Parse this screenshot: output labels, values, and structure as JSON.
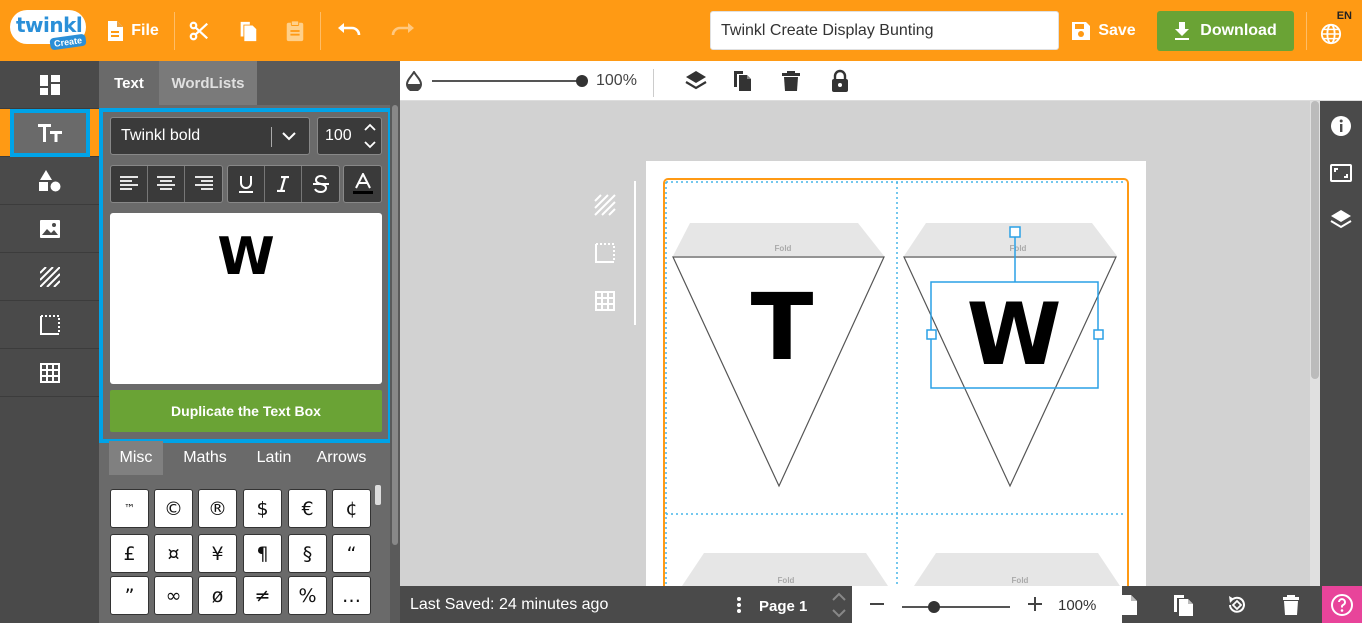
{
  "app": {
    "name": "Twinkl Create",
    "logo_word": "twinkl",
    "logo_badge": "Create"
  },
  "topbar": {
    "file_label": "File",
    "document_title": "Twinkl Create Display Bunting",
    "save_label": "Save",
    "download_label": "Download",
    "language_code": "EN",
    "icons": [
      "file-icon",
      "scissors-icon",
      "copy-icon",
      "paste-icon",
      "undo-icon",
      "redo-icon",
      "save-icon",
      "download-icon",
      "globe-icon"
    ]
  },
  "rail": {
    "items": [
      {
        "name": "templates",
        "icon": "dashboard-icon"
      },
      {
        "name": "text",
        "icon": "text-icon",
        "active": true
      },
      {
        "name": "shapes",
        "icon": "shapes-icon"
      },
      {
        "name": "images",
        "icon": "image-icon"
      },
      {
        "name": "background",
        "icon": "pattern-icon"
      },
      {
        "name": "borders",
        "icon": "border-icon"
      },
      {
        "name": "tables",
        "icon": "grid-icon"
      }
    ]
  },
  "panel": {
    "tabs": [
      {
        "label": "Text",
        "active": true
      },
      {
        "label": "WordLists",
        "active": false
      }
    ],
    "font_family_value": "Twinkl bold",
    "font_size_value": "100",
    "format_buttons": [
      "align-left",
      "align-center",
      "align-right",
      "underline",
      "italic",
      "strikethrough",
      "text-color"
    ],
    "preview_text": "W",
    "duplicate_button": "Duplicate the Text Box",
    "symbol_tabs": [
      {
        "label": "Misc",
        "active": true
      },
      {
        "label": "Maths",
        "active": false
      },
      {
        "label": "Latin",
        "active": false
      },
      {
        "label": "Arrows",
        "active": false
      }
    ],
    "symbols": [
      "™",
      "©",
      "®",
      "$",
      "€",
      "¢",
      "£",
      "¤",
      "¥",
      "¶",
      "§",
      "“",
      "”",
      "∞",
      "ø",
      "≠",
      "%",
      "…"
    ]
  },
  "edit_toolbar": {
    "opacity_value": "100%",
    "opacity_level": 1.0,
    "icons": [
      "opacity-icon",
      "layers-icon",
      "duplicate-icon",
      "delete-icon",
      "lock-icon"
    ]
  },
  "canvas": {
    "side_tools": [
      "background-pattern-icon",
      "border-icon",
      "grid-icon"
    ],
    "fold_label": "Fold",
    "pennants": [
      {
        "letter": "T",
        "selected": false
      },
      {
        "letter": "W",
        "selected": true
      }
    ],
    "colors": {
      "page_border": "#ff9a14",
      "selection": "#2aa0e6",
      "guide": "#47b6e8"
    }
  },
  "right_rail": {
    "icons": [
      "info-icon",
      "fit-screen-icon",
      "layers-icon"
    ]
  },
  "bottombar": {
    "last_saved": "Last Saved: 24 minutes ago",
    "page_label": "Page 1",
    "zoom_value": "100%",
    "zoom_level": 0.3,
    "icons": [
      "add-page-icon",
      "duplicate-page-icon",
      "rotate-page-icon",
      "delete-page-icon",
      "help-icon"
    ]
  },
  "colors": {
    "brand_orange": "#ff9a14",
    "accent_green": "#6aa335",
    "highlight_blue": "#00a3e8",
    "help_pink": "#e8449a"
  }
}
